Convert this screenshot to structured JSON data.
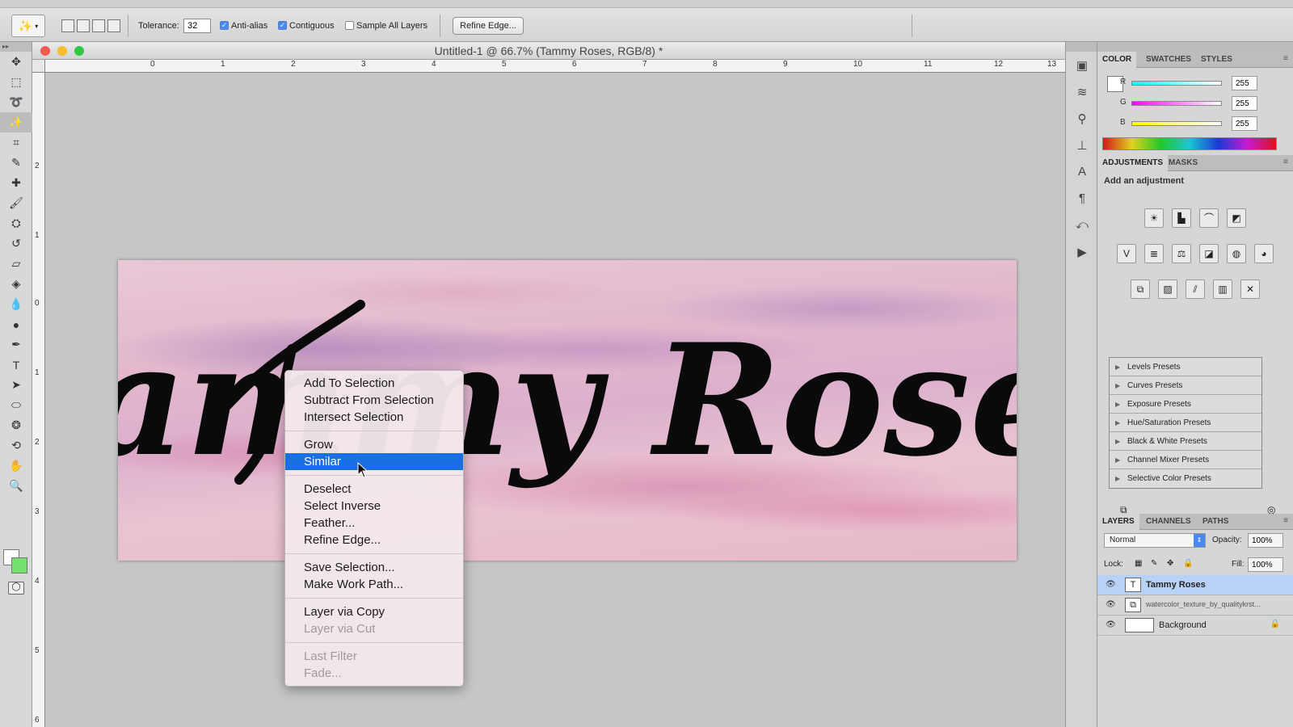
{
  "options_bar": {
    "tolerance_label": "Tolerance:",
    "tolerance_value": "32",
    "anti_alias_label": "Anti-alias",
    "contiguous_label": "Contiguous",
    "sample_all_layers_label": "Sample All Layers",
    "refine_edge_label": "Refine Edge..."
  },
  "document": {
    "title": "Untitled-1 @ 66.7% (Tammy Roses, RGB/8) *",
    "canvas_text": "Tammy Roses",
    "ruler_h": [
      "0",
      "1",
      "2",
      "3",
      "4",
      "5",
      "6",
      "7",
      "8",
      "9",
      "10",
      "11",
      "12",
      "13"
    ],
    "ruler_v": [
      "2",
      "1",
      "0",
      "1",
      "2",
      "3",
      "4",
      "5",
      "6"
    ]
  },
  "context_menu": {
    "groups": [
      [
        {
          "label": "Add To Selection"
        },
        {
          "label": "Subtract From Selection"
        },
        {
          "label": "Intersect Selection"
        }
      ],
      [
        {
          "label": "Grow"
        },
        {
          "label": "Similar",
          "highlighted": true
        }
      ],
      [
        {
          "label": "Deselect"
        },
        {
          "label": "Select Inverse"
        },
        {
          "label": "Feather..."
        },
        {
          "label": "Refine Edge..."
        }
      ],
      [
        {
          "label": "Save Selection..."
        },
        {
          "label": "Make Work Path..."
        }
      ],
      [
        {
          "label": "Layer via Copy"
        },
        {
          "label": "Layer via Cut",
          "disabled": true
        }
      ],
      [
        {
          "label": "Last Filter",
          "disabled": true
        },
        {
          "label": "Fade...",
          "disabled": true
        }
      ]
    ]
  },
  "color_panel": {
    "tabs": [
      "COLOR",
      "SWATCHES",
      "STYLES"
    ],
    "channels": [
      {
        "name": "R",
        "value": "255"
      },
      {
        "name": "G",
        "value": "255"
      },
      {
        "name": "B",
        "value": "255"
      }
    ],
    "foreground": "#ffffff",
    "background": "#71e06c"
  },
  "adjustments_panel": {
    "tabs": [
      "ADJUSTMENTS",
      "MASKS"
    ],
    "heading": "Add an adjustment",
    "presets": [
      "Levels Presets",
      "Curves Presets",
      "Exposure Presets",
      "Hue/Saturation Presets",
      "Black & White Presets",
      "Channel Mixer Presets",
      "Selective Color Presets"
    ]
  },
  "layers_panel": {
    "tabs": [
      "LAYERS",
      "CHANNELS",
      "PATHS"
    ],
    "blend_mode": "Normal",
    "opacity_label": "Opacity:",
    "opacity_value": "100%",
    "lock_label": "Lock:",
    "fill_label": "Fill:",
    "fill_value": "100%",
    "layers": [
      {
        "name": "Tammy Roses",
        "selected": true
      },
      {
        "name": "watercolor_texture_by_qualitykrst...",
        "selected": false
      },
      {
        "name": "Background",
        "selected": false
      }
    ]
  },
  "colors": {
    "highlight": "#1b6fe0",
    "layer_selected": "#b7d2f5"
  }
}
